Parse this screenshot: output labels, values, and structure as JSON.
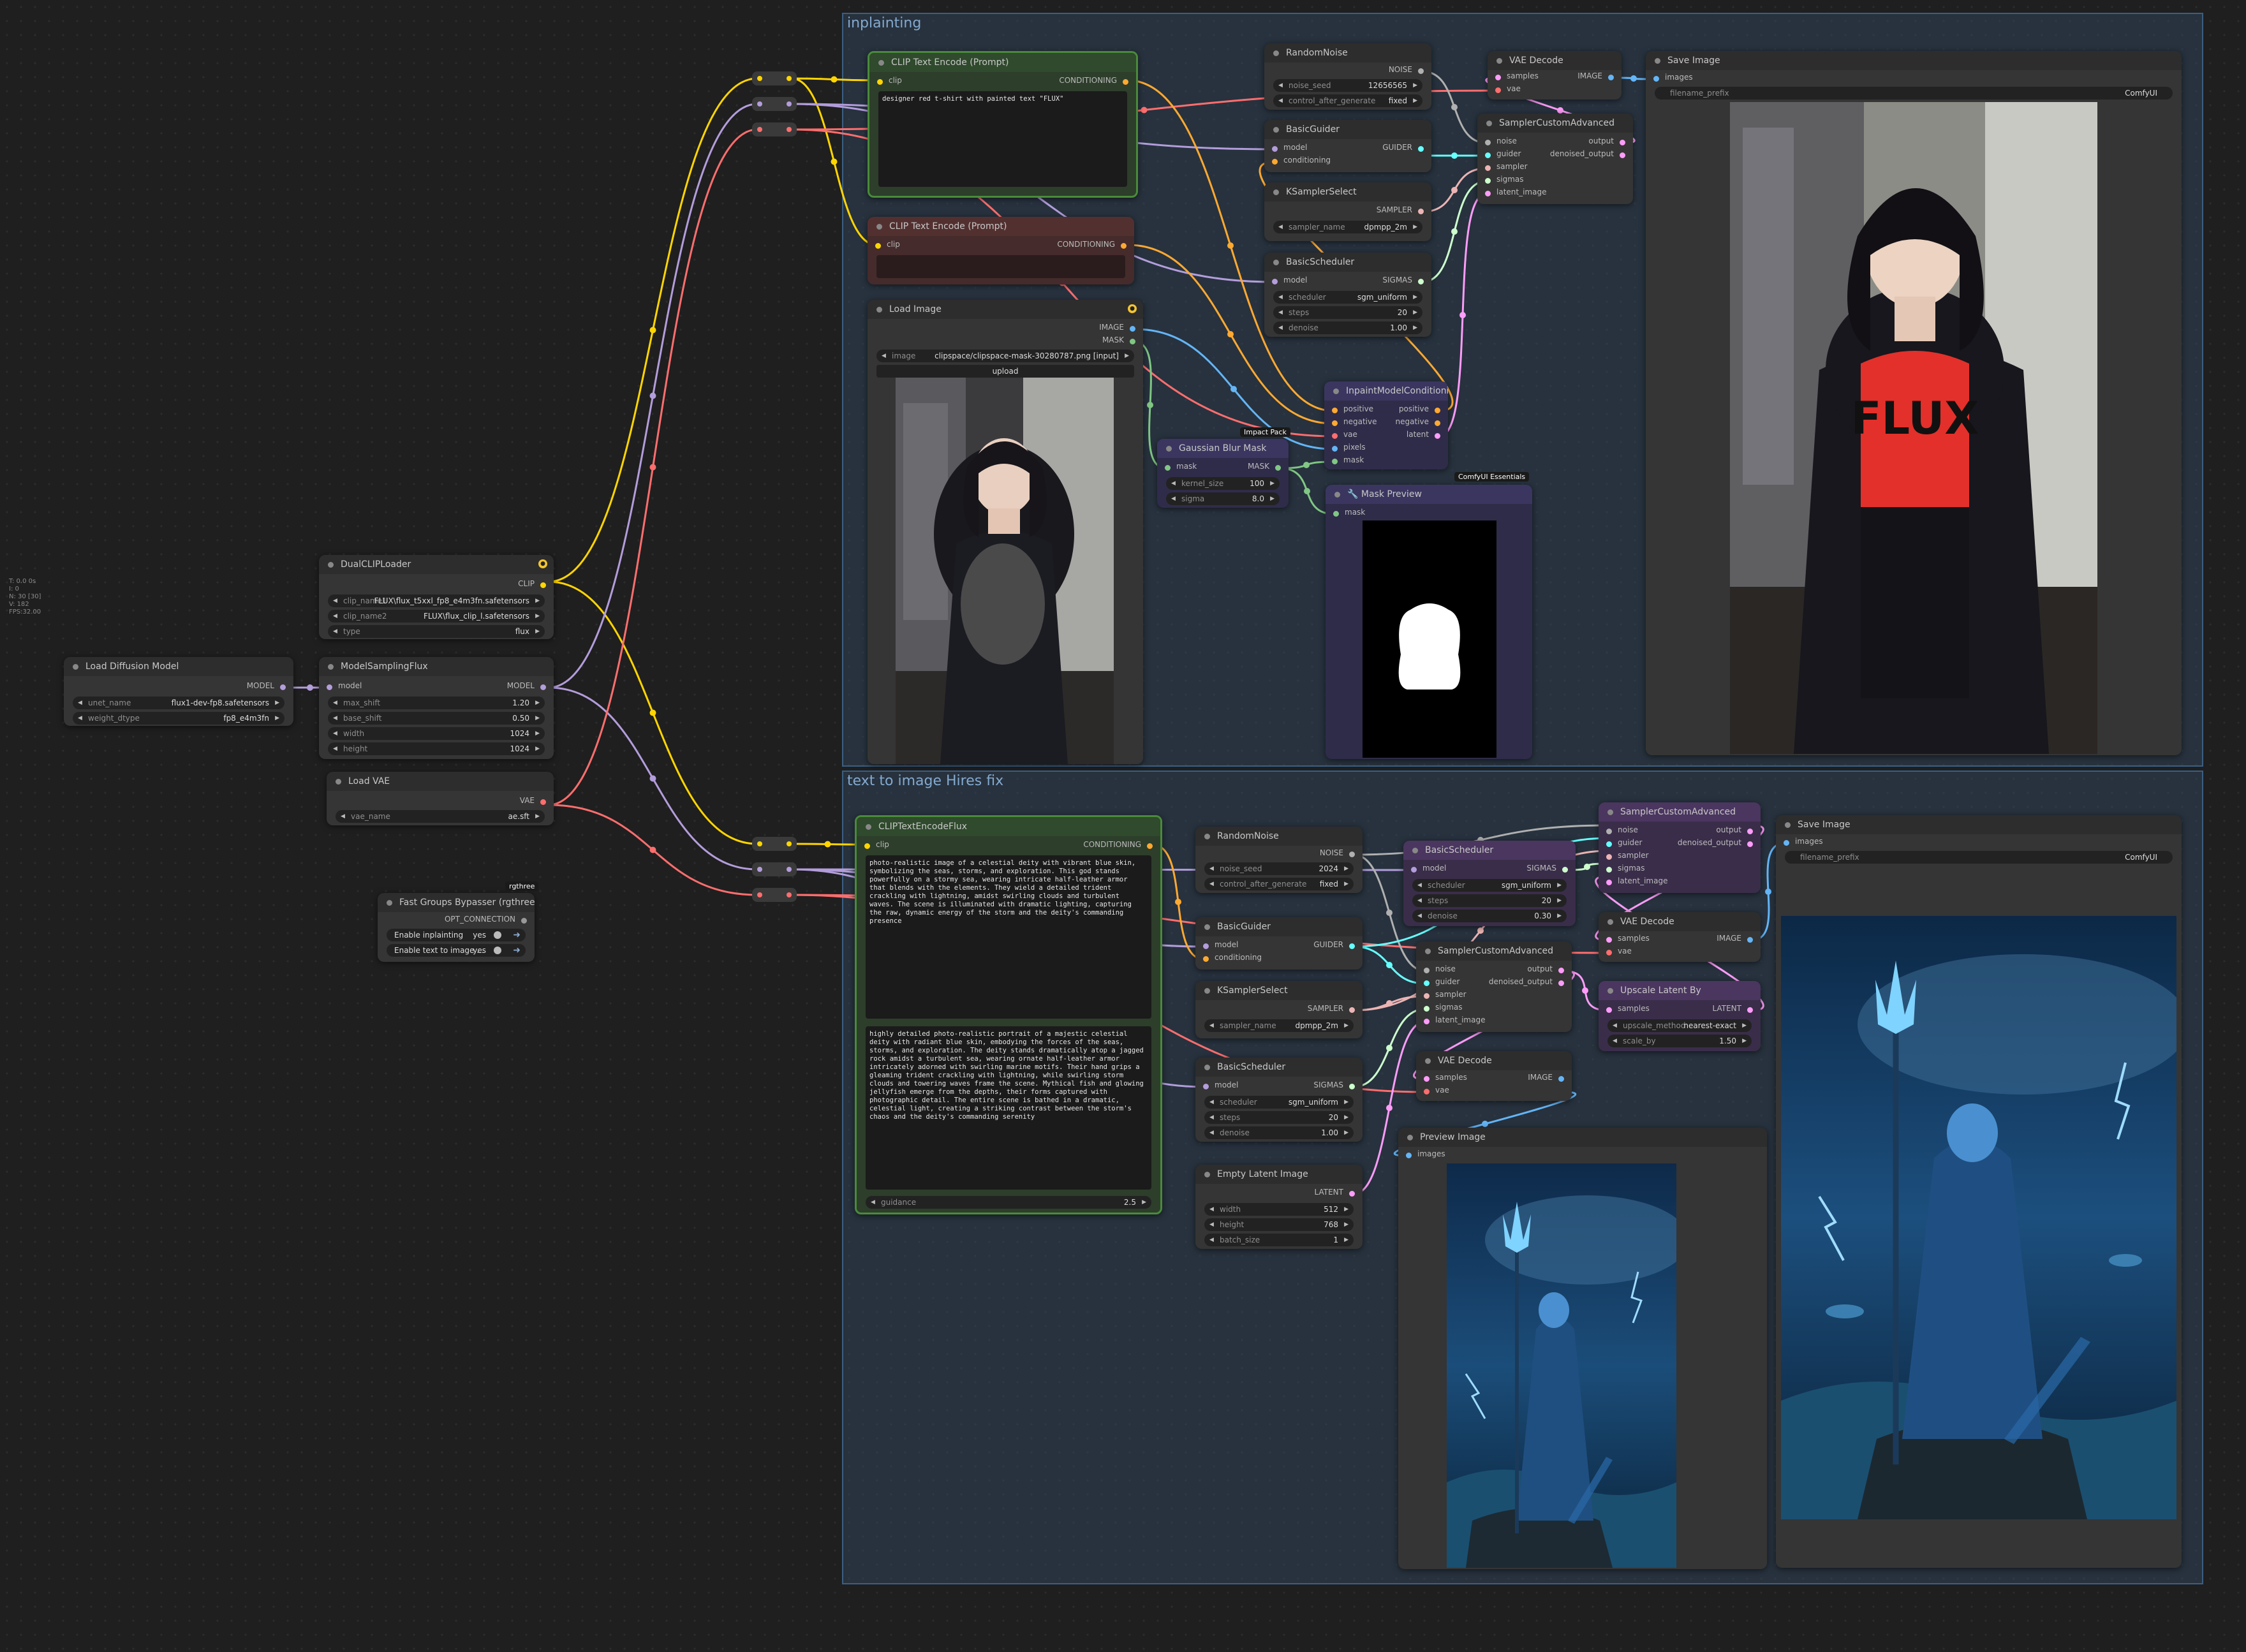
{
  "canvas_stats": [
    "T: 0.0 0s",
    "I: 0",
    "N: 30 [30]",
    "V: 182",
    "FPS:32.00"
  ],
  "colors": {
    "clip": "#ffd500",
    "model": "#b39ddb",
    "vae": "#ff6e6e",
    "conditioning": "#ffa931",
    "image": "#64b5f6",
    "mask": "#81c784",
    "latent": "#ff9cf9",
    "noise": "#b0b0b0",
    "guider": "#66ffff",
    "sampler": "#ecb4b4",
    "sigmas": "#cdffcd"
  },
  "groups": {
    "inpaint": "inplainting",
    "t2i": "text to image Hires fix"
  },
  "sockets": {
    "clip": "clip",
    "conditioning": "CONDITIONING",
    "model": "model",
    "model_out": "MODEL",
    "clip_out": "CLIP",
    "vae": "vae",
    "vae_out": "VAE",
    "image_out": "IMAGE",
    "mask_out": "MASK",
    "mask": "mask",
    "noise_out": "NOISE",
    "guider_out": "GUIDER",
    "sampler_out": "SAMPLER",
    "sigmas_out": "SIGMAS",
    "latent_out": "LATENT",
    "conditioning_in": "conditioning",
    "samples": "samples",
    "images": "images",
    "noise": "noise",
    "guider": "guider",
    "sampler": "sampler",
    "sigmas": "sigmas",
    "latent_image": "latent_image",
    "output": "output",
    "denoised_output": "denoised_output",
    "positive": "positive",
    "negative": "negative",
    "pixels": "pixels",
    "latent": "latent",
    "opt_connection": "OPT_CONNECTION"
  },
  "left": {
    "load_diffusion": {
      "title": "Load Diffusion Model",
      "unet_name_label": "unet_name",
      "unet_name": "flux1-dev-fp8.safetensors",
      "weight_dtype_label": "weight_dtype",
      "weight_dtype": "fp8_e4m3fn"
    },
    "dual_clip": {
      "title": "DualCLIPLoader",
      "clip_name1_label": "clip_name1",
      "clip_name1": "FLUX\\flux_t5xxl_fp8_e4m3fn.safetensors",
      "clip_name2_label": "clip_name2",
      "clip_name2": "FLUX\\flux_clip_l.safetensors",
      "type_label": "type",
      "type": "flux"
    },
    "model_sampling": {
      "title": "ModelSamplingFlux",
      "max_shift_label": "max_shift",
      "max_shift": "1.20",
      "base_shift_label": "base_shift",
      "base_shift": "0.50",
      "width_label": "width",
      "width": "1024",
      "height_label": "height",
      "height": "1024"
    },
    "load_vae": {
      "title": "Load VAE",
      "vae_name_label": "vae_name",
      "vae_name": "ae.sft"
    },
    "fast_groups": {
      "title": "Fast Groups Bypasser (rgthree)",
      "badge": "rgthree",
      "enable1": "Enable inplainting",
      "enable2": "Enable text to image ...",
      "yes": "yes"
    }
  },
  "inpaint": {
    "clip_pos": {
      "title": "CLIP Text Encode (Prompt)",
      "text": "designer red t-shirt with painted text \"FLUX\""
    },
    "clip_neg": {
      "title": "CLIP Text Encode (Prompt)"
    },
    "load_image": {
      "title": "Load Image",
      "image_label": "image",
      "image": "clipspace/clipspace-mask-30280787.png [input]",
      "upload": "upload"
    },
    "random_noise": {
      "title": "RandomNoise",
      "noise_seed_label": "noise_seed",
      "noise_seed": "12656565",
      "control_label": "control_after_generate",
      "control": "fixed"
    },
    "basic_guider": {
      "title": "BasicGuider"
    },
    "ksampler_select": {
      "title": "KSamplerSelect",
      "sampler_name_label": "sampler_name",
      "sampler_name": "dpmpp_2m"
    },
    "basic_scheduler": {
      "title": "BasicScheduler",
      "scheduler_label": "scheduler",
      "scheduler": "sgm_uniform",
      "steps_label": "steps",
      "steps": "20",
      "denoise_label": "denoise",
      "denoise": "1.00"
    },
    "inpaint_cond": {
      "title": "InpaintModelConditioning"
    },
    "gaussian": {
      "title": "Gaussian Blur Mask",
      "badge": "Impact Pack",
      "kernel_label": "kernel_size",
      "kernel": "100",
      "sigma_label": "sigma",
      "sigma": "8.0"
    },
    "mask_preview": {
      "title": "🔧 Mask Preview",
      "badge": "ComfyUI Essentials"
    },
    "vae_decode": {
      "title": "VAE Decode"
    },
    "sampler_adv": {
      "title": "SamplerCustomAdvanced"
    },
    "save_image": {
      "title": "Save Image",
      "prefix_label": "filename_prefix",
      "prefix": "ComfyUI"
    },
    "shirt_text": "FLUX"
  },
  "t2i": {
    "clip_flux": {
      "title": "CLIPTextEncodeFlux",
      "clip_l": "photo-realistic image of a celestial deity with vibrant blue skin, symbolizing the seas, storms, and exploration. This god stands powerfully on a stormy sea, wearing intricate half-leather armor that blends with the elements. They wield a detailed trident crackling with lightning, amidst swirling clouds and turbulent waves. The scene is illuminated with dramatic lighting, capturing the raw, dynamic energy of the storm and the deity's commanding presence",
      "t5xxl": "highly detailed photo-realistic portrait of a majestic celestial deity with radiant blue skin, embodying the forces of the seas, storms, and exploration. The deity stands dramatically atop a jagged rock amidst a turbulent sea, wearing ornate half-leather armor intricately adorned with swirling marine motifs. Their hand grips a gleaming trident crackling with lightning, while swirling storm clouds and towering waves frame the scene. Mythical fish and glowing jellyfish emerge from the depths, their forms captured with photographic detail. The entire scene is bathed in a dramatic, celestial light, creating a striking contrast between the storm's chaos and the deity's commanding serenity",
      "guidance_label": "guidance",
      "guidance": "2.5"
    },
    "random_noise": {
      "title": "RandomNoise",
      "noise_seed_label": "noise_seed",
      "noise_seed": "2024",
      "control_label": "control_after_generate",
      "control": "fixed"
    },
    "basic_guider": {
      "title": "BasicGuider"
    },
    "ksampler_select": {
      "title": "KSamplerSelect",
      "sampler_name_label": "sampler_name",
      "sampler_name": "dpmpp_2m"
    },
    "basic_scheduler": {
      "title": "BasicScheduler",
      "scheduler_label": "scheduler",
      "scheduler": "sgm_uniform",
      "steps_label": "steps",
      "steps": "20",
      "denoise_label": "denoise",
      "denoise": "1.00"
    },
    "basic_scheduler2": {
      "title": "BasicScheduler",
      "scheduler_label": "scheduler",
      "scheduler": "sgm_uniform",
      "steps_label": "steps",
      "steps": "20",
      "denoise_label": "denoise",
      "denoise": "0.30"
    },
    "empty_latent": {
      "title": "Empty Latent Image",
      "width_label": "width",
      "width": "512",
      "height_label": "height",
      "height": "768",
      "batch_label": "batch_size",
      "batch": "1"
    },
    "sampler_adv": {
      "title": "SamplerCustomAdvanced"
    },
    "sampler_adv2": {
      "title": "SamplerCustomAdvanced"
    },
    "vae_decode": {
      "title": "VAE Decode"
    },
    "vae_decode2": {
      "title": "VAE Decode"
    },
    "upscale": {
      "title": "Upscale Latent By",
      "method_label": "upscale_method",
      "method": "nearest-exact",
      "scale_label": "scale_by",
      "scale": "1.50"
    },
    "preview": {
      "title": "Preview Image"
    },
    "save_image": {
      "title": "Save Image",
      "prefix_label": "filename_prefix",
      "prefix": "ComfyUI"
    }
  }
}
